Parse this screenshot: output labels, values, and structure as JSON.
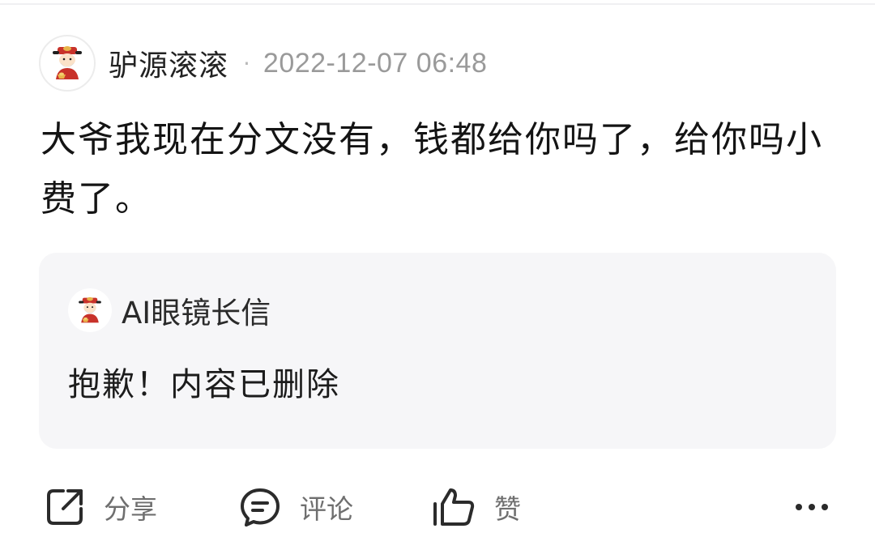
{
  "post": {
    "author": "驴源滚滚",
    "separator": "·",
    "timestamp": "2022-12-07 06:48",
    "text": "大爷我现在分文没有，钱都给你吗了，给你吗小费了。",
    "avatar_icon": "fortune-god-avatar-icon"
  },
  "quote": {
    "author": "AI眼镜长信",
    "text": "抱歉！内容已删除",
    "avatar_icon": "fortune-god-avatar-icon"
  },
  "actions": {
    "share_label": "分享",
    "comment_label": "评论",
    "like_label": "赞",
    "share_icon": "share-icon",
    "comment_icon": "comment-icon",
    "like_icon": "thumbs-up-icon",
    "more_icon": "more-dots-icon"
  },
  "colors": {
    "card_background": "#f6f6f8",
    "timestamp": "#9a9a9a",
    "action_label": "#6f6f6f",
    "avatar_red": "#c8322a",
    "avatar_gold": "#e8b44a"
  }
}
